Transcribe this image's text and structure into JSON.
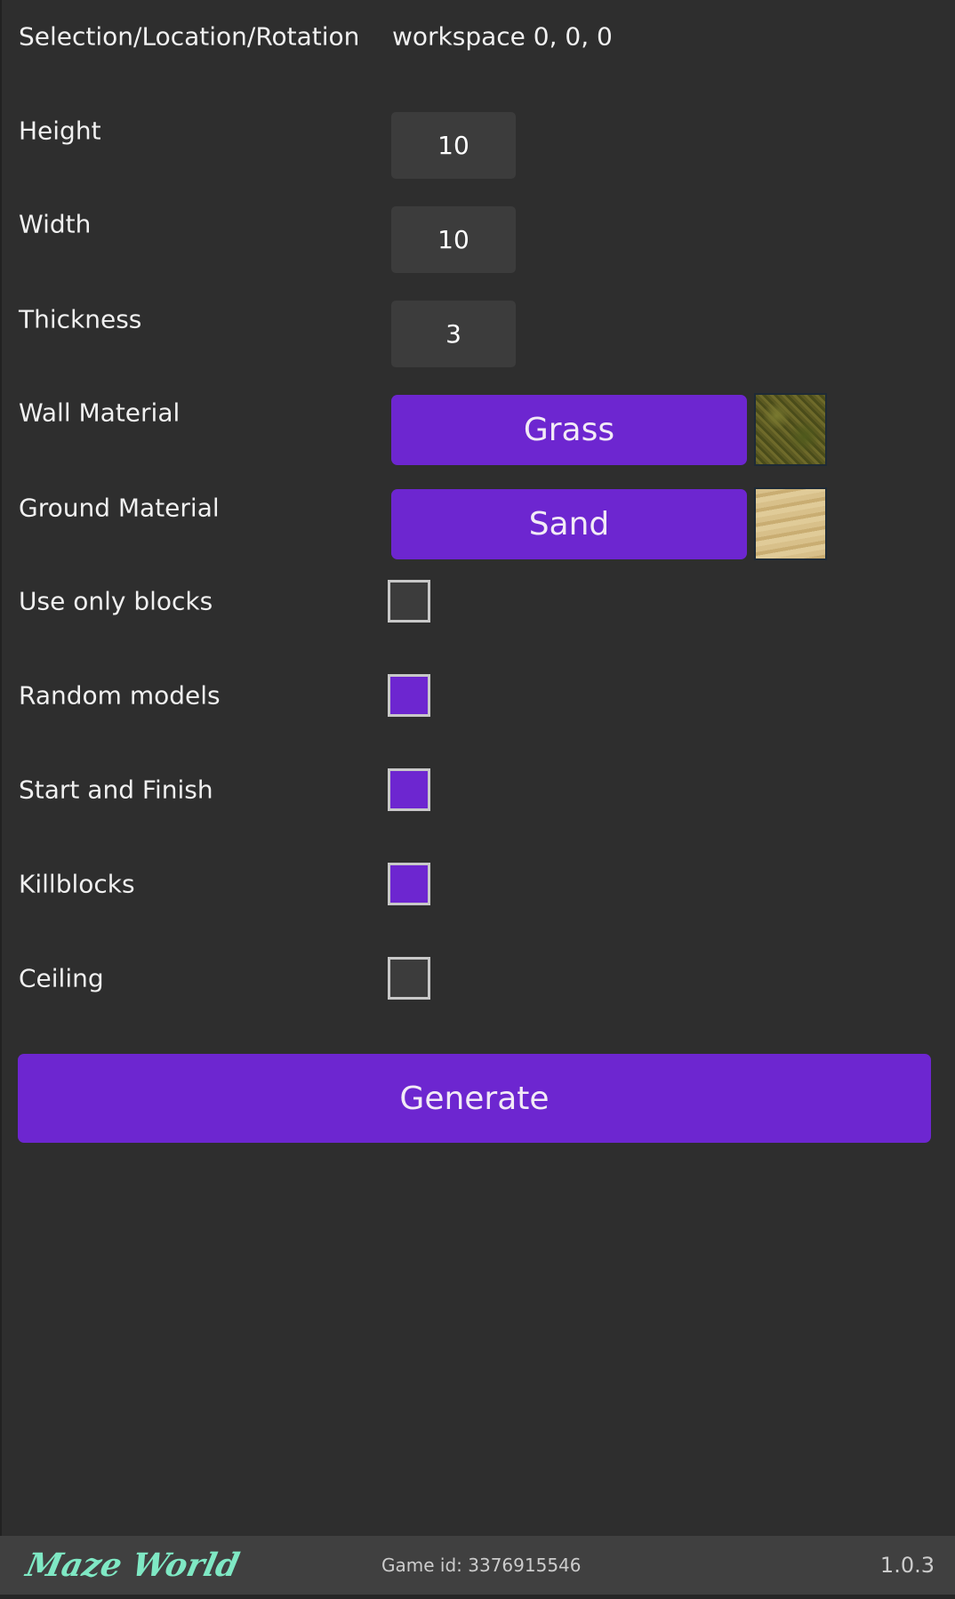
{
  "selection": {
    "label": "Selection/Location/Rotation",
    "value": "workspace 0, 0, 0"
  },
  "fields": [
    {
      "label": "Height",
      "value": "10"
    },
    {
      "label": "Width",
      "value": "10"
    },
    {
      "label": "Thickness",
      "value": "3"
    }
  ],
  "materials": [
    {
      "label": "Wall Material",
      "value": "Grass"
    },
    {
      "label": "Ground Material",
      "value": "Sand"
    }
  ],
  "options": [
    {
      "label": "Use only blocks",
      "checked": false
    },
    {
      "label": "Random models",
      "checked": true
    },
    {
      "label": "Start and Finish",
      "checked": true
    },
    {
      "label": "Killblocks",
      "checked": true
    },
    {
      "label": "Ceiling",
      "checked": false
    }
  ],
  "generate_label": "Generate",
  "footer": {
    "logo": "Maze World",
    "game_id": "Game id: 3376915546",
    "version": "1.0.3"
  },
  "colors": {
    "accent": "#6d26d0",
    "logo": "#7fe8c4"
  }
}
